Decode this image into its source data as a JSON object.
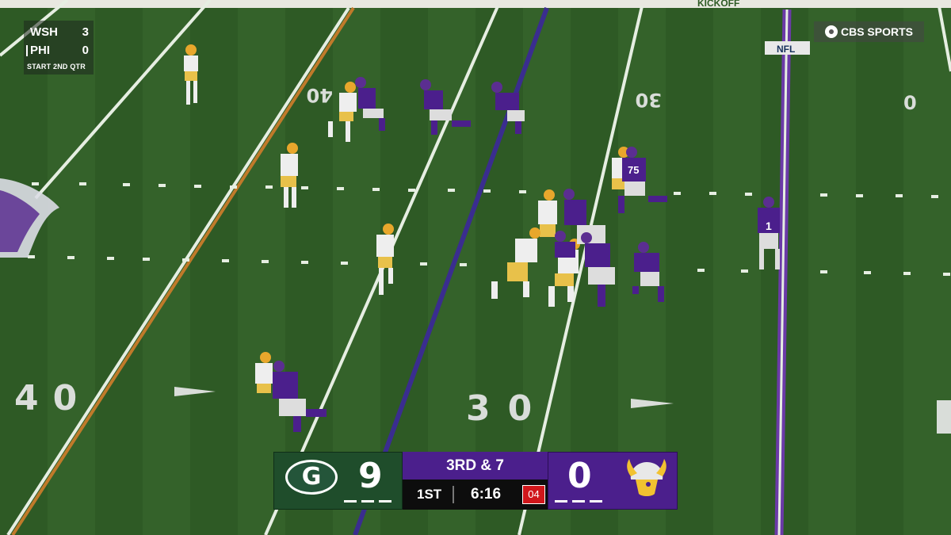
{
  "ticker": {
    "team1": "WSH",
    "score1": "3",
    "team2": "PHI",
    "score2": "0",
    "state": "START  2ND QTR"
  },
  "network": {
    "label": "CBS SPORTS",
    "icon": "cbs-eye-icon"
  },
  "field": {
    "yard_numbers": [
      "40",
      "30",
      "40",
      "30"
    ],
    "end_banner": "KICKOFF",
    "shield_label": "NFL",
    "colors": {
      "turf": "#2f5a26",
      "first_down_line": "#3a2d8f",
      "scrimmage_line": "#c07a2a",
      "goal_stripe": "#6b3aa8"
    }
  },
  "scorebug": {
    "home": {
      "logo": "packers-g-logo",
      "score": "9",
      "color": "#1f4d2b"
    },
    "down_distance": "3RD & 7",
    "quarter": "1ST",
    "clock": "6:16",
    "play_clock": "04",
    "away": {
      "logo": "vikings-logo",
      "score": "0",
      "color": "#4b1f8c"
    }
  },
  "players": {
    "jersey_numbers": [
      "75",
      "1"
    ]
  }
}
